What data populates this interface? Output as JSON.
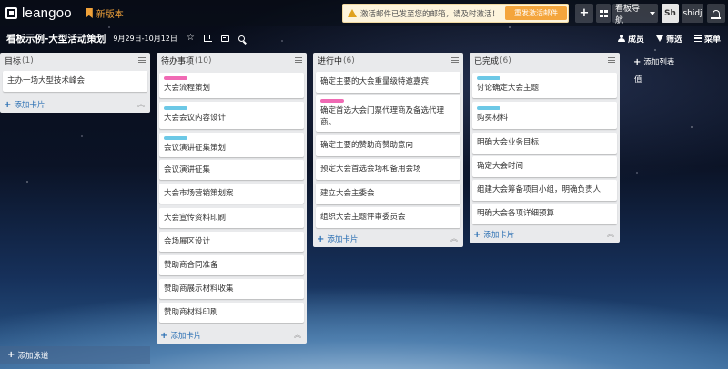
{
  "app": {
    "logo": "leangoo",
    "new_version": "新版本",
    "notice": "激活邮件已发至您的邮箱，请及时激活！",
    "resend_label": "重发激活邮件",
    "plus_label": "+",
    "board_nav_label": "看板导航",
    "avatar_initials": "Sh",
    "username": "shidj"
  },
  "board": {
    "title": "看板示例-大型活动策划",
    "dates": "9月29日-10月12日",
    "members_label": "成员",
    "filter_label": "筛选",
    "menu_label": "菜单",
    "add_list_label": "添加列表",
    "add_list_sub": "值",
    "add_lane_label": "添加泳道"
  },
  "add_card_label": "添加卡片",
  "label_colors": {
    "pink": "#f06ab4",
    "blue": "#6cc8e6"
  },
  "lists": [
    {
      "title": "目标",
      "count": "(1)",
      "cards": [
        {
          "text": "主办一场大型技术峰会",
          "label": ""
        }
      ]
    },
    {
      "title": "待办事项",
      "count": "(10)",
      "cards": [
        {
          "text": "大会流程策划",
          "label": "pink"
        },
        {
          "text": "大会会议内容设计",
          "label": "blue"
        },
        {
          "text": "会议演讲征集策划",
          "label": "blue"
        },
        {
          "text": "会议演讲征集",
          "label": ""
        },
        {
          "text": "大会市场营销策划案",
          "label": ""
        },
        {
          "text": "大会宣传资料印刷",
          "label": ""
        },
        {
          "text": "会场展区设计",
          "label": ""
        },
        {
          "text": "赞助商合同准备",
          "label": ""
        },
        {
          "text": "赞助商展示材料收集",
          "label": ""
        },
        {
          "text": "赞助商材料印刷",
          "label": ""
        }
      ]
    },
    {
      "title": "进行中",
      "count": "(6)",
      "cards": [
        {
          "text": "确定主要的大会重量级特邀嘉宾",
          "label": ""
        },
        {
          "text": "确定首选大会门票代理商及备选代理商。",
          "label": "pink"
        },
        {
          "text": "确定主要的赞助商赞助意向",
          "label": ""
        },
        {
          "text": "预定大会首选会场和备用会场",
          "label": ""
        },
        {
          "text": "建立大会主委会",
          "label": ""
        },
        {
          "text": "组织大会主题评审委员会",
          "label": ""
        }
      ]
    },
    {
      "title": "已完成",
      "count": "(6)",
      "cards": [
        {
          "text": "讨论确定大会主题",
          "label": "blue"
        },
        {
          "text": "购买材料",
          "label": "blue"
        },
        {
          "text": "明确大会业务目标",
          "label": ""
        },
        {
          "text": "确定大会时间",
          "label": ""
        },
        {
          "text": "组建大会筹备项目小组，明确负责人",
          "label": ""
        },
        {
          "text": "明确大会各项详细预算",
          "label": ""
        }
      ]
    }
  ]
}
